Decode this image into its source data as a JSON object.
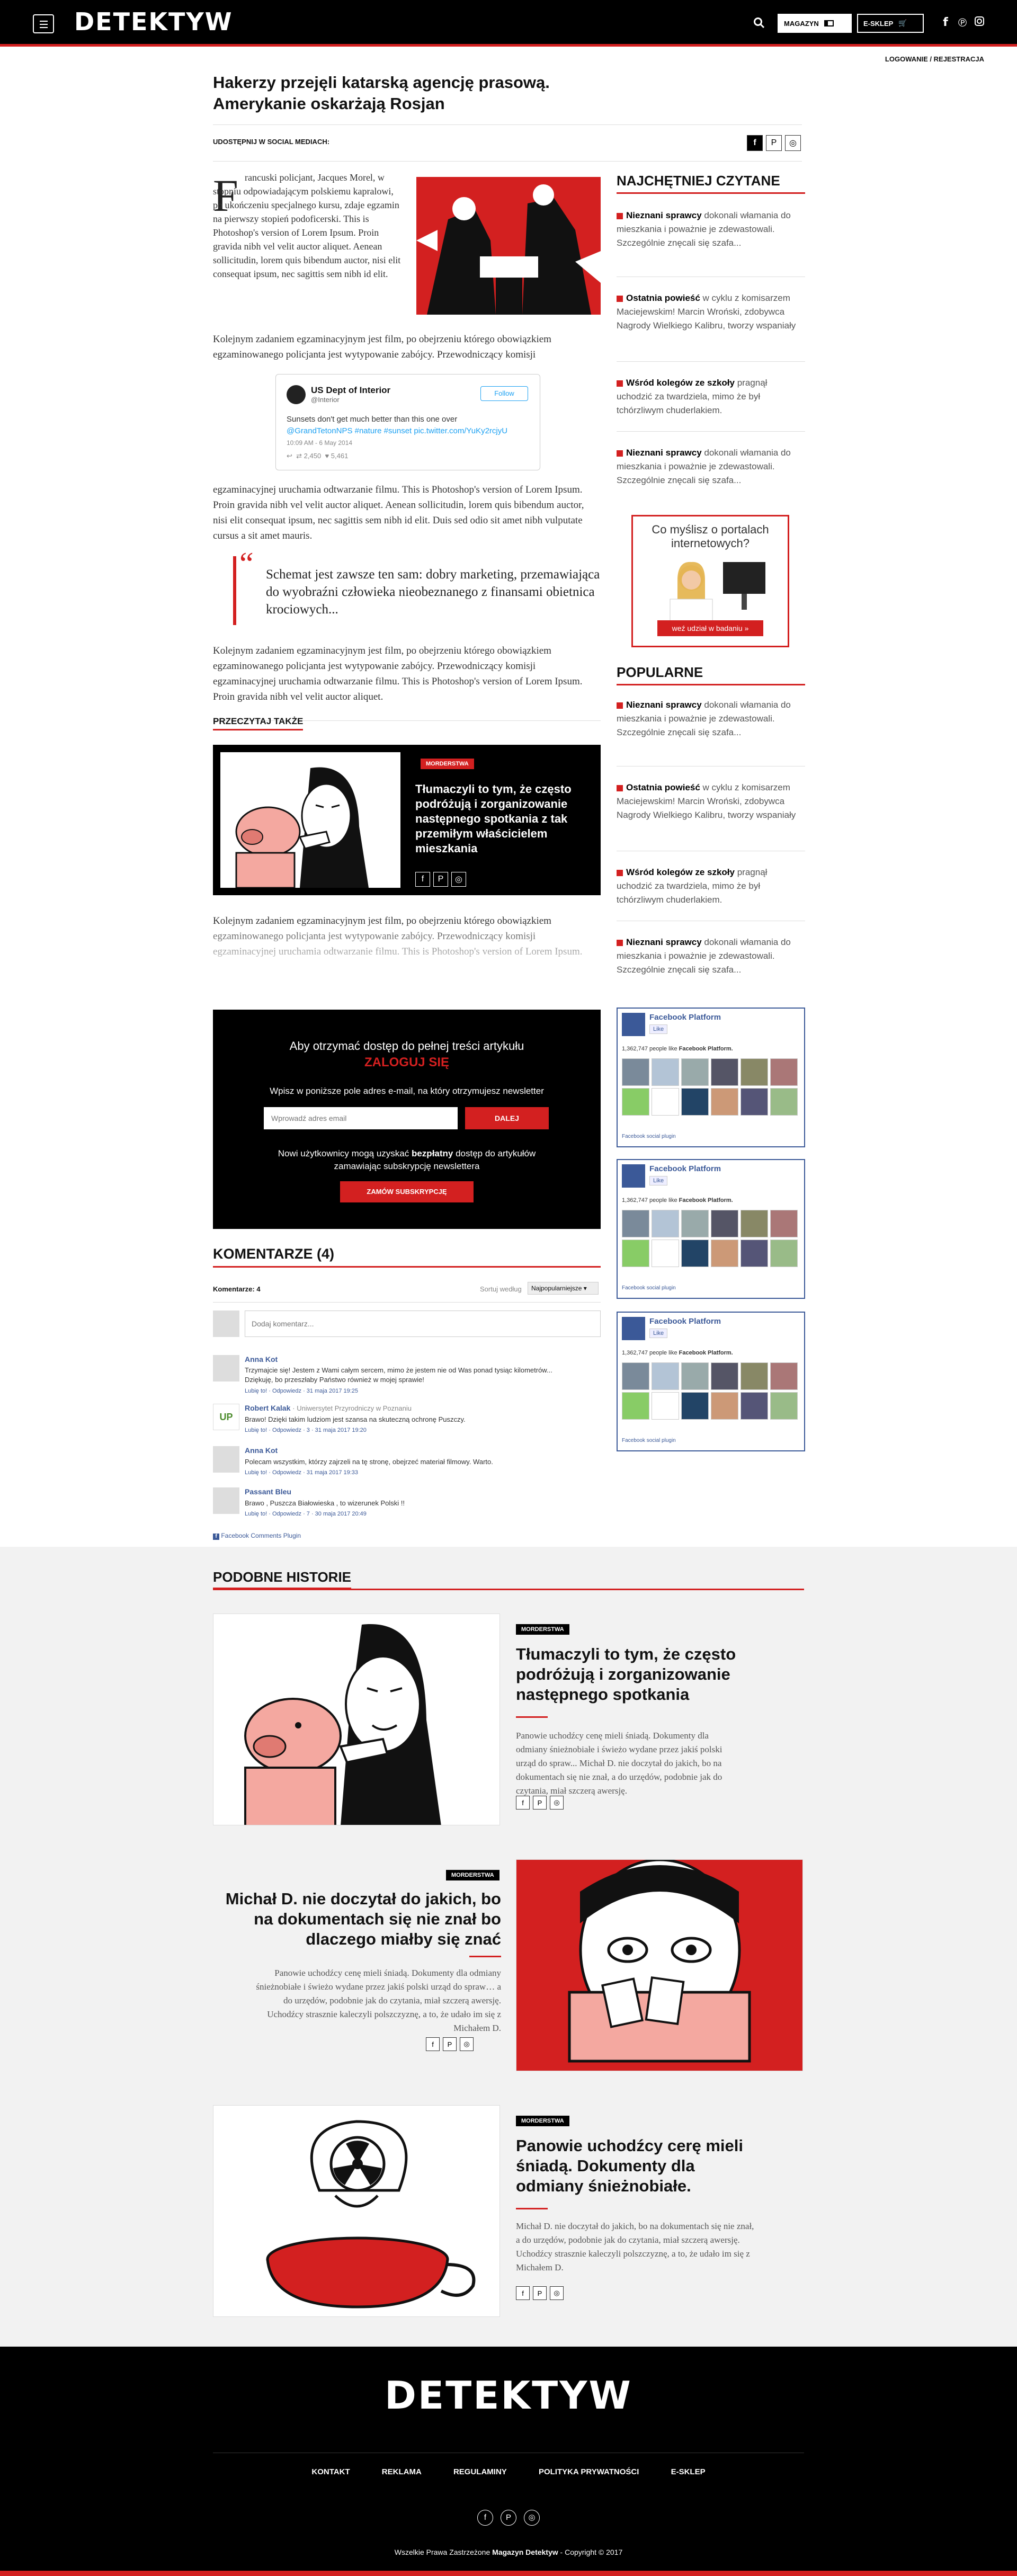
{
  "header": {
    "logo": "DETEKTYW",
    "magazine_label": "MAGAZYN",
    "shop_label": "E-SKLEP",
    "auth": "LOGOWANIE / REJESTRACJA"
  },
  "article": {
    "title": "Hakerzy przejęli katarską agencję prasową. Amerykanie oskarżają Rosjan",
    "share_label": "UDOSTĘPNIJ W SOCIAL MEDIACH:",
    "dropcap": "F",
    "para1": "rancuski policjant, Jacques Morel, w stopniu odpowiadającym polskiemu kapralowi, po ukończeniu specjalnego kursu, zdaje egzamin na pierwszy stopień podoficerski. This is Photoshop's version of Lorem Ipsum. Proin gravida nibh vel velit auctor aliquet. Aenean sollicitudin, lorem quis bibendum auctor, nisi elit consequat ipsum, nec sagittis sem nibh id elit.",
    "para2": "Kolejnym zadaniem egzaminacyjnym jest film, po obejrzeniu którego obowiązkiem egzaminowanego policjanta jest wytypowanie zabójcy. Przewodniczący komisji",
    "para3": "egzaminacyjnej uruchamia odtwarzanie filmu. This is Photoshop's version of Lorem Ipsum. Proin gravida nibh vel velit auctor aliquet. Aenean sollicitudin, lorem quis bibendum auctor, nisi elit consequat ipsum, nec sagittis sem nibh id elit. Duis sed odio sit amet nibh vulputate cursus a sit amet mauris.",
    "quote": "Schemat jest zawsze ten sam: dobry marketing, przemawiająca do wyobraźni człowieka nieobeznanego z finansami obietnica krociowych...",
    "para4": "Kolejnym zadaniem egzaminacyjnym jest film, po obejrzeniu którego obowiązkiem egzaminowanego policjanta jest wytypowanie zabójcy. Przewodniczący komisji egzaminacyjnej uruchamia odtwarzanie filmu. This is Photoshop's version of Lorem Ipsum. Proin gravida nibh vel velit auctor aliquet.",
    "fade_text": "Kolejnym zadaniem egzaminacyjnym jest film, po obejrzeniu którego obowiązkiem egzaminowanego policjanta jest wytypowanie zabójcy. Przewodniczący komisji egzaminacyjnej uruchamia odtwarzanie filmu. This is Photoshop's version of Lorem Ipsum."
  },
  "tweet": {
    "name": "US Dept of Interior",
    "handle": "@Interior",
    "follow": "Follow",
    "text": "Sunsets don't get much better than this one over",
    "link": "@GrandTetonNPS #nature #sunset pic.twitter.com/YuKy2rcjyU",
    "date": "10:09 AM - 6 May 2014",
    "retweets": "2,450",
    "likes": "5,461"
  },
  "read_also": {
    "heading": "PRZECZYTAJ TAKŻE",
    "badge": "MORDERSTWA",
    "title": "Tłumaczyli to tym, że często podróżują i zorganizowanie następnego spotkania z tak przemiłym właścicielem mieszkania"
  },
  "paywall": {
    "line1": "Aby otrzymać dostęp do pełnej treści artykułu",
    "login": "ZALOGUJ SIĘ",
    "line2": "Wpisz w poniższe pole adres e-mail, na który otrzymujesz newsletter",
    "email_placeholder": "Wprowadź adres email",
    "next": "DALEJ",
    "line3a": "Nowi użytkownicy mogą uzyskać ",
    "line3b": "bezpłatny",
    "line3c": " dostęp do artykułów",
    "line4": "zamawiając subskrypcję newslettera",
    "subscribe": "ZAMÓW SUBSKRYPCJĘ"
  },
  "comments": {
    "title": "KOMENTARZE (4)",
    "count_label": "Komentarze: 4",
    "sort_label": "Sortuj według",
    "sort_value": "Najpopularniejsze",
    "input_placeholder": "Dodaj komentarz...",
    "items": [
      {
        "name": "Anna Kot",
        "text": "Trzymajcie się! Jestem z Wami całym sercem, mimo że jestem nie od Was ponad tysiąc kilometrów... Dziękuję, bo przeszłaby Państwo również w mojej sprawie!",
        "meta": "Lubię to! · Odpowiedz · 31 maja 2017 19:25"
      },
      {
        "name": "Robert Kalak",
        "extra": "· Uniwersytet Przyrodniczy w Poznaniu",
        "text": "Brawo! Dzięki takim ludziom jest szansa na skuteczną ochronę Puszczy.",
        "meta": "Lubię to! · Odpowiedz · 3 · 31 maja 2017 19:20"
      },
      {
        "name": "Anna Kot",
        "text": "Polecam wszystkim, którzy zajrzeli na tę stronę, obejrzeć materiał filmowy. Warto.",
        "meta": "Lubię to! · Odpowiedz · 31 maja 2017 19:33"
      },
      {
        "name": "Passant Bleu",
        "text": "Brawo , Puszcza Białowieska , to wizerunek Polski !!",
        "meta": "Lubię to! · Odpowiedz · 7 · 30 maja 2017 20:49"
      }
    ],
    "plugin": "Facebook Comments Plugin"
  },
  "sidebar": {
    "most_read_heading": "NAJCHĘTNIEJ CZYTANE",
    "popular_heading": "POPULARNE",
    "items": [
      {
        "bold": "Nieznani sprawcy",
        "text": " dokonali włamania do mieszkania i poważnie je zdewastowali. Szczególnie znęcali się szafa..."
      },
      {
        "bold": "Ostatnia powieść",
        "text": " w cyklu z komisarzem Maciejewskim! Marcin Wroński, zdobywca Nagrody Wielkiego Kalibru, tworzy wspaniały"
      },
      {
        "bold": "Wśród kolegów ze szkoły",
        "text": " pragnął uchodzić za twardziela, mimo że był tchórzliwym chuderlakiem."
      },
      {
        "bold": "Nieznani sprawcy",
        "text": " dokonali włamania do mieszkania i poważnie je zdewastowali. Szczególnie znęcali się szafa..."
      }
    ],
    "ad_text": "Co myślisz o portalach internetowych?",
    "ad_button": "weź udział w badaniu »",
    "fb": {
      "name": "Facebook Platform",
      "like": "Like",
      "count": "1,362,747 people like",
      "count_name": "Facebook Platform.",
      "plugin": "Facebook social plugin"
    }
  },
  "similar": {
    "heading": "PODOBNE HISTORIE",
    "stories": [
      {
        "badge": "MORDERSTWA",
        "title": "Tłumaczyli to tym, że często podróżują i zorganizowanie następnego spotkania",
        "text": "Panowie uchodźcy cenę mieli śniadą. Dokumenty dla odmiany śnieżnobiałe i świeżo wydane przez jakiś polski urząd do spraw... Michał D. nie doczytał do jakich, bo na dokumentach się nie znał, a do urzędów, podobnie jak do czytania, miał szczerą awersję."
      },
      {
        "badge": "MORDERSTWA",
        "title": "Michał D. nie doczytał do jakich, bo na dokumentach się nie znał bo dlaczego miałby się znać",
        "text": "Panowie uchodźcy cenę mieli śniadą. Dokumenty dla odmiany śnieżnobiałe i świeżo wydane przez jakiś polski urząd do spraw… a do urzędów, podobnie jak do czytania, miał szczerą awersję. Uchodźcy strasznie kaleczyli polszczyznę, a to, że udało im się z Michałem D."
      },
      {
        "badge": "MORDERSTWA",
        "title": "Panowie uchodźcy cerę mieli śniadą. Dokumenty dla odmiany śnieżnobiałe.",
        "text": "Michał D. nie doczytał do jakich, bo na dokumentach się nie znał, a do urzędów, podobnie jak do czytania, miał szczerą awersję. Uchodźcy strasznie kaleczyli polszczyznę, a to, że udało im się z Michałem D."
      }
    ]
  },
  "footer": {
    "logo": "DETEKTYW",
    "nav": [
      "KONTAKT",
      "REKLAMA",
      "REGULAMINY",
      "POLITYKA PRYWATNOŚCI",
      "E-SKLEP"
    ],
    "copyright_a": "Wszelkie Prawa Zastrzeżone ",
    "copyright_b": "Magazyn Detektyw",
    "copyright_c": " - Copyright © 2017"
  },
  "colors": {
    "accent": "#d32020",
    "facebook": "#3b5998",
    "dark": "#000000"
  }
}
